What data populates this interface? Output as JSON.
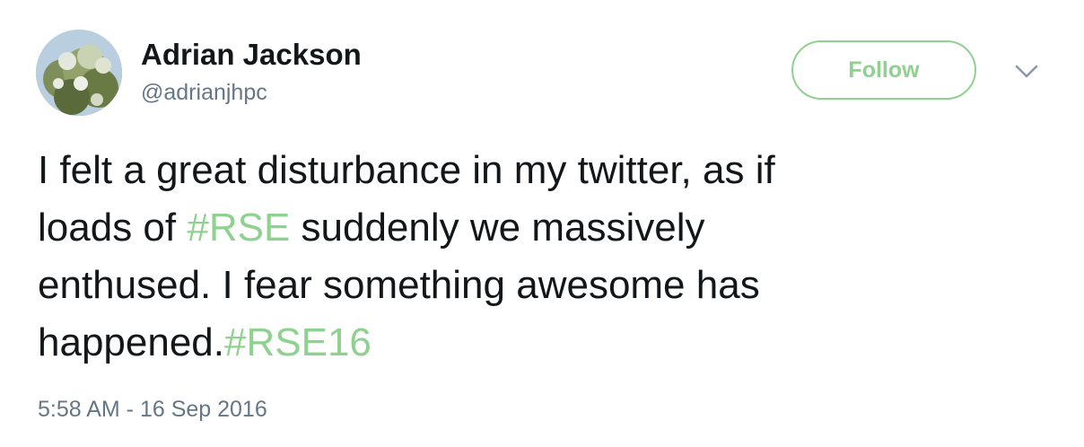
{
  "tweet": {
    "author": {
      "display_name": "Adrian Jackson",
      "handle": "@adrianjhpc",
      "avatar_icon": "avatar-photo"
    },
    "follow_label": "Follow",
    "menu_icon": "chevron-down-icon",
    "text": {
      "line1": "I felt a great disturbance in my twitter, as if",
      "line2_pre": "loads of ",
      "hashtag1": "#RSE",
      "line2_post": " suddenly we massively",
      "line3": "enthused. I fear something awesome has",
      "line4_pre": "happened.",
      "hashtag2": "#RSE16"
    },
    "timestamp": "5:58 AM - 16 Sep 2016",
    "colors": {
      "accent": "#8fd18f",
      "text": "#14171a",
      "secondary": "#657786"
    }
  }
}
